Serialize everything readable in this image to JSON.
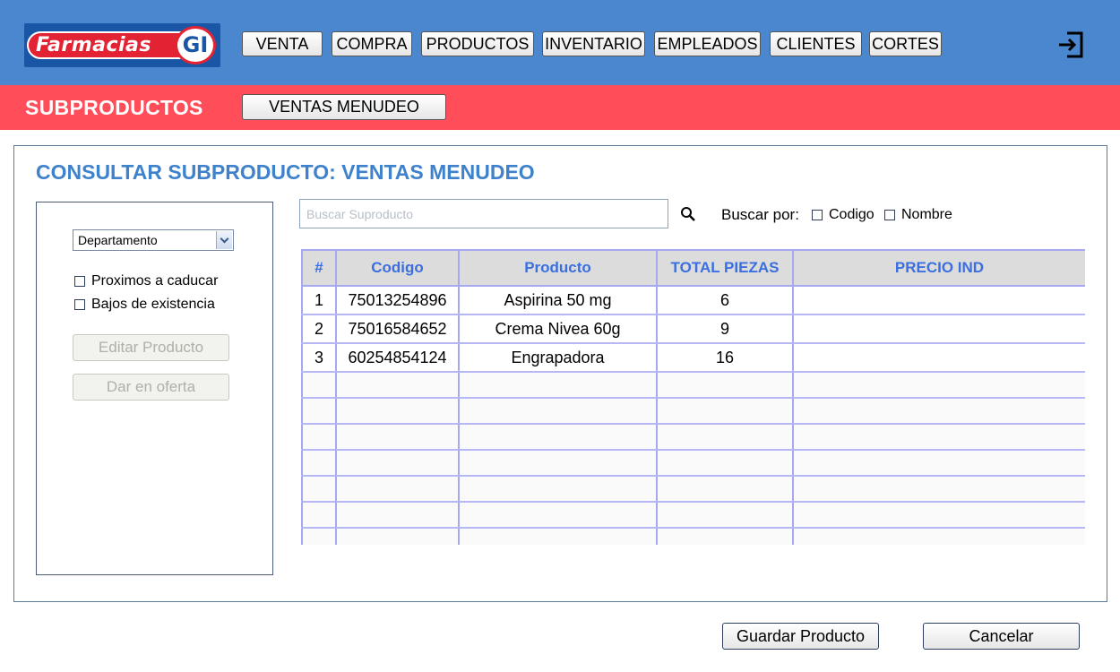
{
  "brand": {
    "logo_text": "Farmacias",
    "logo_badge": "GI"
  },
  "nav": {
    "items": [
      {
        "label": "VENTA"
      },
      {
        "label": "COMPRA"
      },
      {
        "label": "PRODUCTOS"
      },
      {
        "label": "INVENTARIO"
      },
      {
        "label": "EMPLEADOS"
      },
      {
        "label": "CLIENTES"
      },
      {
        "label": "CORTES"
      }
    ]
  },
  "subnav": {
    "title": "SUBPRODUCTOS",
    "button_label": "VENTAS MENUDEO"
  },
  "panel": {
    "title": "CONSULTAR SUBPRODUCTO: VENTAS MENUDEO",
    "filters": {
      "department_selected": "Departamento",
      "check_caducar": "Proximos a caducar",
      "check_existencia": "Bajos de existencia",
      "edit_button": "Editar Producto",
      "offer_button": "Dar en oferta"
    },
    "search": {
      "placeholder": "Buscar Suproducto",
      "by_label": "Buscar por:",
      "opt_codigo": "Codigo",
      "opt_nombre": "Nombre"
    },
    "table": {
      "headers": [
        "#",
        "Codigo",
        "Producto",
        "TOTAL PIEZAS",
        "PRECIO IND"
      ],
      "rows": [
        [
          "1",
          "75013254896",
          "Aspirina 50 mg",
          "6",
          ""
        ],
        [
          "2",
          "75016584652",
          "Crema Nivea 60g",
          "9",
          ""
        ],
        [
          "3",
          "60254854124",
          "Engrapadora",
          "16",
          ""
        ]
      ]
    }
  },
  "footer": {
    "save_label": "Guardar Producto",
    "cancel_label": "Cancelar"
  },
  "colors": {
    "topbar": "#4a87cf",
    "subbar": "#ff4d5a",
    "title": "#3f82cc",
    "header_text": "#3b6fe0"
  }
}
